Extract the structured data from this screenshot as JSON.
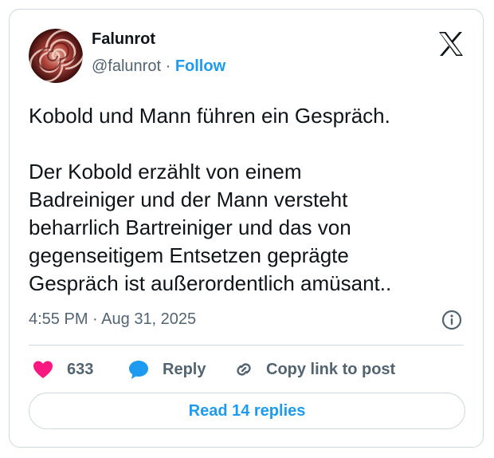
{
  "author": {
    "name": "Falunrot",
    "handle": "@falunrot",
    "separator": "·",
    "follow_label": "Follow",
    "avatar_icon": "spiral-avatar"
  },
  "platform_icon": "x-logo-icon",
  "tweet": {
    "line1": "Kobold und Mann führen ein Gespräch.",
    "body_lines": [
      "Der Kobold erzählt von einem",
      "Badreiniger und der Mann versteht",
      "beharrlich Bartreiniger und das von",
      "gegenseitigem Entsetzen geprägte",
      "Gespräch ist außerordentlich amüsant.."
    ]
  },
  "meta": {
    "time": "4:55 PM",
    "separator": "·",
    "date": "Aug 31, 2025"
  },
  "actions": {
    "like_count": "633",
    "reply_label": "Reply",
    "copy_label": "Copy link to post"
  },
  "read_replies_label": "Read 14 replies",
  "colors": {
    "accent": "#1d9bf0",
    "heart": "#f91880",
    "text": "#0f1419",
    "muted": "#536471",
    "border": "#cfd9de"
  }
}
